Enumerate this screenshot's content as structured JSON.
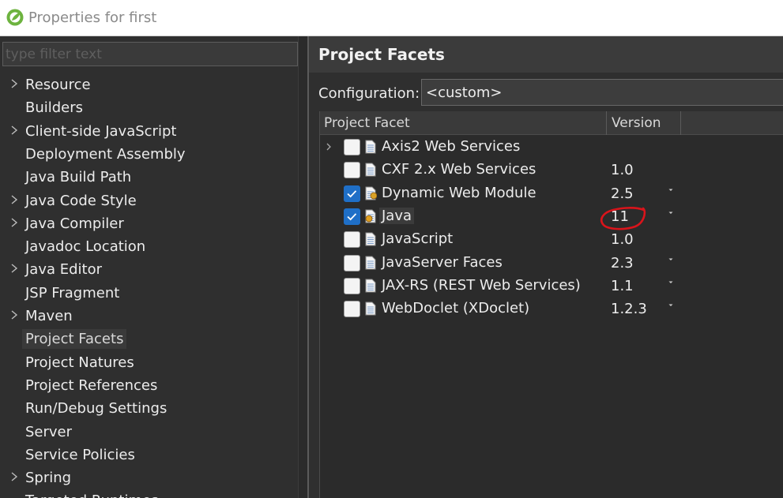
{
  "window": {
    "title": "Properties for first",
    "icon": "spring-leaf-icon"
  },
  "filter": {
    "placeholder": "type filter text",
    "value": ""
  },
  "tree": {
    "items": [
      {
        "label": "Resource",
        "expandable": true,
        "selected": false
      },
      {
        "label": "Builders",
        "expandable": false,
        "selected": false
      },
      {
        "label": "Client-side JavaScript",
        "expandable": true,
        "selected": false
      },
      {
        "label": "Deployment Assembly",
        "expandable": false,
        "selected": false
      },
      {
        "label": "Java Build Path",
        "expandable": false,
        "selected": false
      },
      {
        "label": "Java Code Style",
        "expandable": true,
        "selected": false
      },
      {
        "label": "Java Compiler",
        "expandable": true,
        "selected": false
      },
      {
        "label": "Javadoc Location",
        "expandable": false,
        "selected": false
      },
      {
        "label": "Java Editor",
        "expandable": true,
        "selected": false
      },
      {
        "label": "JSP Fragment",
        "expandable": false,
        "selected": false
      },
      {
        "label": "Maven",
        "expandable": true,
        "selected": false
      },
      {
        "label": "Project Facets",
        "expandable": false,
        "selected": true
      },
      {
        "label": "Project Natures",
        "expandable": false,
        "selected": false
      },
      {
        "label": "Project References",
        "expandable": false,
        "selected": false
      },
      {
        "label": "Run/Debug Settings",
        "expandable": false,
        "selected": false
      },
      {
        "label": "Server",
        "expandable": false,
        "selected": false
      },
      {
        "label": "Service Policies",
        "expandable": false,
        "selected": false
      },
      {
        "label": "Spring",
        "expandable": true,
        "selected": false
      },
      {
        "label": "Targeted Runtimes",
        "expandable": false,
        "selected": false
      }
    ]
  },
  "page": {
    "title": "Project Facets",
    "configuration_label": "Configuration:",
    "configuration_value": "<custom>"
  },
  "facets_table": {
    "columns": [
      "Project Facet",
      "Version"
    ],
    "rows": [
      {
        "name": "Axis2 Web Services",
        "version": "",
        "checked": false,
        "expandable": true,
        "has_dropdown": false,
        "icon": "document-icon"
      },
      {
        "name": "CXF 2.x Web Services",
        "version": "1.0",
        "checked": false,
        "expandable": false,
        "has_dropdown": false,
        "icon": "document-icon"
      },
      {
        "name": "Dynamic Web Module",
        "version": "2.5",
        "checked": true,
        "expandable": false,
        "has_dropdown": true,
        "icon": "web-module-icon"
      },
      {
        "name": "Java",
        "version": "11",
        "checked": true,
        "expandable": false,
        "has_dropdown": true,
        "icon": "java-facet-icon",
        "highlighted": true
      },
      {
        "name": "JavaScript",
        "version": "1.0",
        "checked": false,
        "expandable": false,
        "has_dropdown": false,
        "icon": "document-icon"
      },
      {
        "name": "JavaServer Faces",
        "version": "2.3",
        "checked": false,
        "expandable": false,
        "has_dropdown": true,
        "icon": "document-icon"
      },
      {
        "name": "JAX-RS (REST Web Services)",
        "version": "1.1",
        "checked": false,
        "expandable": false,
        "has_dropdown": true,
        "icon": "document-icon"
      },
      {
        "name": "WebDoclet (XDoclet)",
        "version": "1.2.3",
        "checked": false,
        "expandable": false,
        "has_dropdown": true,
        "icon": "document-icon"
      }
    ]
  },
  "annotation": {
    "icon": "red-circle-annotation-icon",
    "color": "#d9141b"
  },
  "colors": {
    "checkbox_checked": "#1f6fc7",
    "background": "#2f2f2f",
    "header": "#3b3b3b"
  }
}
